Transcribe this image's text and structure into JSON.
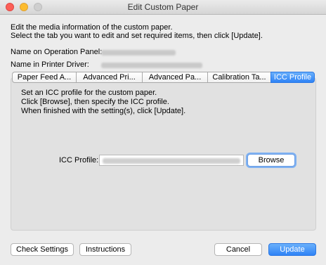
{
  "window": {
    "title": "Edit Custom Paper"
  },
  "intro": {
    "line1": "Edit the media information of the custom paper.",
    "line2": "Select the tab you want to edit and set required items, then click [Update]."
  },
  "info": {
    "operation_panel_label": "Name on Operation Panel:",
    "printer_driver_label": "Name in Printer Driver:"
  },
  "tabs": [
    {
      "label": "Paper Feed A..."
    },
    {
      "label": "Advanced Pri..."
    },
    {
      "label": "Advanced Pa..."
    },
    {
      "label": "Calibration Ta..."
    },
    {
      "label": "ICC Profile",
      "selected": true
    }
  ],
  "icc": {
    "instruction1": "Set an ICC profile for the custom paper.",
    "instruction2": "Click [Browse], then specify the ICC profile.",
    "instruction3": "When finished with the setting(s), click [Update].",
    "profile_label": "ICC Profile:",
    "browse_label": "Browse"
  },
  "footer": {
    "check_settings": "Check Settings",
    "instructions": "Instructions",
    "cancel": "Cancel",
    "update": "Update"
  },
  "colors": {
    "accent": "#2f83f6",
    "window_bg": "#ececec"
  }
}
